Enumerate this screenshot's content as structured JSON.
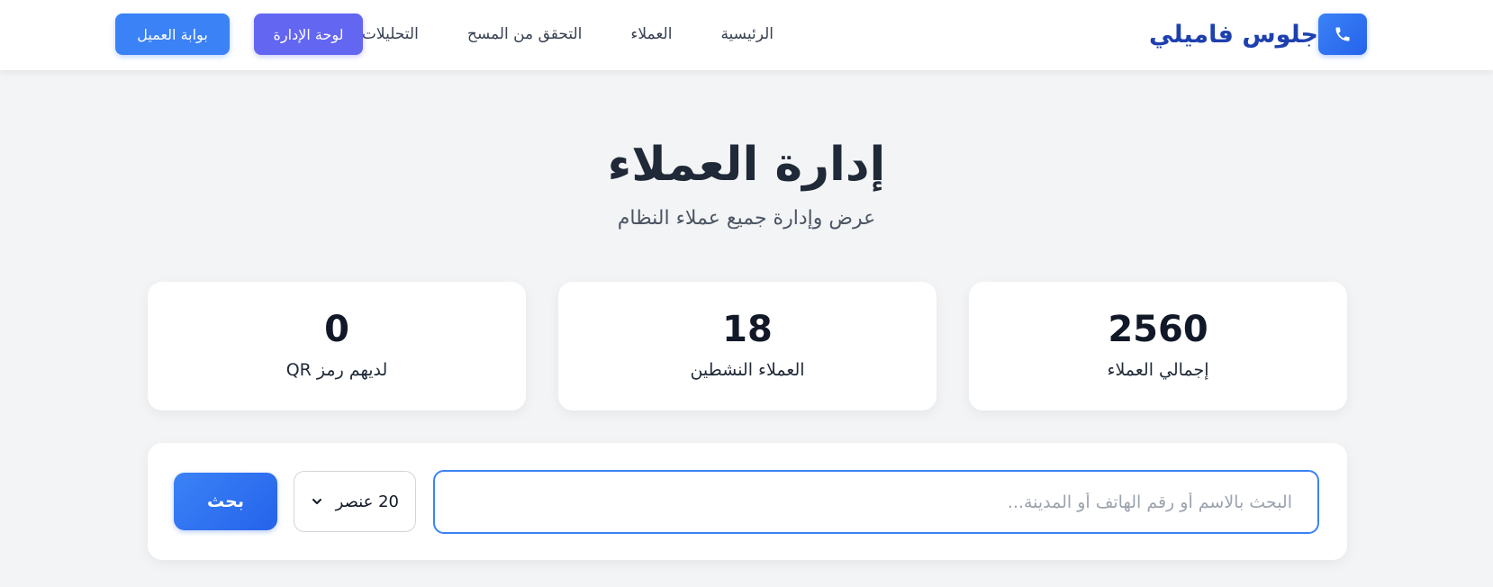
{
  "header": {
    "brand_name": "جلوس فاميلي",
    "brand_icon": "phone-icon",
    "nav_items": [
      {
        "label": "الرئيسية"
      },
      {
        "label": "العملاء"
      },
      {
        "label": "التحقق من المسح"
      },
      {
        "label": "التحليلات"
      }
    ],
    "admin_button_label": "لوحة الإدارة",
    "portal_button_label": "بوابة العميل",
    "colors": {
      "brand": "#1e40af",
      "admin_button": "#6366f1",
      "portal_button": "#3b82f6"
    }
  },
  "page": {
    "title": "إدارة العملاء",
    "subtitle": "عرض وإدارة جميع عملاء النظام"
  },
  "stats": [
    {
      "value": "2560",
      "label": "إجمالي العملاء"
    },
    {
      "value": "18",
      "label": "العملاء النشطين"
    },
    {
      "value": "0",
      "label": "لديهم رمز QR"
    }
  ],
  "search": {
    "placeholder": "البحث بالاسم أو رقم الهاتف أو المدينة...",
    "value": "",
    "per_page_selected": "20 عنصر",
    "button_label": "بحث",
    "accent": "#3b82f6"
  }
}
